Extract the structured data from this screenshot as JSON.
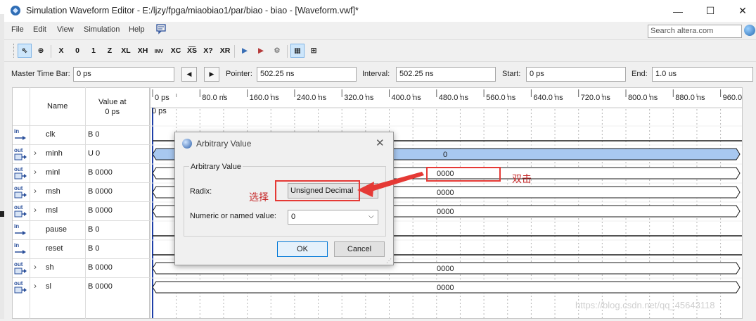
{
  "window": {
    "title": "Simulation Waveform Editor - E:/ljzy/fpga/miaobiao1/par/biao - biao - [Waveform.vwf]*",
    "minimize_glyph": "—",
    "maximize_glyph": "☐",
    "close_glyph": "✕"
  },
  "menu": {
    "items": [
      "File",
      "Edit",
      "View",
      "Simulation",
      "Help"
    ],
    "search_placeholder": "Search altera.com"
  },
  "toolbar": {
    "buttons": [
      {
        "name": "selection-tool",
        "glyph": "⇖"
      },
      {
        "name": "zoom-tool",
        "glyph": "⊕"
      },
      {
        "name": "forcing-unknown",
        "glyph": "X"
      },
      {
        "name": "forcing-low",
        "glyph": "0"
      },
      {
        "name": "forcing-high",
        "glyph": "1"
      },
      {
        "name": "high-impedance",
        "glyph": "Z"
      },
      {
        "name": "weak-low",
        "glyph": "XL"
      },
      {
        "name": "weak-high",
        "glyph": "XH"
      },
      {
        "name": "invert",
        "glyph": "INV"
      },
      {
        "name": "count-value",
        "glyph": "XC"
      },
      {
        "name": "clock",
        "glyph": "X͞S"
      },
      {
        "name": "arbitrary-value",
        "glyph": "X?"
      },
      {
        "name": "random-value",
        "glyph": "XR"
      },
      {
        "name": "run-functional",
        "glyph": "▶"
      },
      {
        "name": "run-timing",
        "glyph": "▶"
      },
      {
        "name": "generate-netlist",
        "glyph": "⚙"
      },
      {
        "name": "snap-grid",
        "glyph": "▦"
      },
      {
        "name": "grid-settings",
        "glyph": "⊞"
      }
    ]
  },
  "timebar": {
    "master_label": "Master Time Bar:",
    "master_value": "0 ps",
    "pointer_label": "Pointer:",
    "pointer_value": "502.25 ns",
    "interval_label": "Interval:",
    "interval_value": "502.25 ns",
    "start_label": "Start:",
    "start_value": "0 ps",
    "end_label": "End:",
    "end_value": "1.0 us"
  },
  "table": {
    "header_name": "Name",
    "header_value_line1": "Value at",
    "header_value_line2": "0 ps",
    "signals": [
      {
        "dir": "in",
        "name": "clk",
        "value": "B 0",
        "expandable": false
      },
      {
        "dir": "out",
        "name": "minh",
        "value": "U 0",
        "expandable": true
      },
      {
        "dir": "out",
        "name": "minl",
        "value": "B 0000",
        "expandable": true
      },
      {
        "dir": "out",
        "name": "msh",
        "value": "B 0000",
        "expandable": true
      },
      {
        "dir": "out",
        "name": "msl",
        "value": "B 0000",
        "expandable": true
      },
      {
        "dir": "in",
        "name": "pause",
        "value": "B 0",
        "expandable": false
      },
      {
        "dir": "in",
        "name": "reset",
        "value": "B 0",
        "expandable": false
      },
      {
        "dir": "out",
        "name": "sh",
        "value": "B 0000",
        "expandable": true
      },
      {
        "dir": "out",
        "name": "sl",
        "value": "B 0000",
        "expandable": true
      }
    ]
  },
  "waveform": {
    "time_ticks": [
      "0 ps",
      "80.0 ns",
      "160.0 ns",
      "240.0 ns",
      "320.0 ns",
      "400.0 ns",
      "480.0 ns",
      "560.0 ns",
      "640.0 ns",
      "720.0 ns",
      "800.0 ns",
      "880.0 ns",
      "960.0 ns"
    ],
    "cursor_label": "0 ps",
    "bus_values": {
      "minh": "0",
      "minl": "0000",
      "msh": "0000",
      "msl": "0000",
      "sh": "0000",
      "sl": "0000"
    }
  },
  "dialog": {
    "title": "Arbitrary Value",
    "group_label": "Arbitrary Value",
    "radix_label": "Radix:",
    "radix_value": "Unsigned Decimal",
    "value_label": "Numeric or named value:",
    "value_value": "0",
    "ok_label": "OK",
    "cancel_label": "Cancel"
  },
  "annotations": {
    "select_text": "选择",
    "double_click_text": "双击",
    "color": "#e53935"
  },
  "watermark": "https://blog.csdn.net/qq_45643118"
}
